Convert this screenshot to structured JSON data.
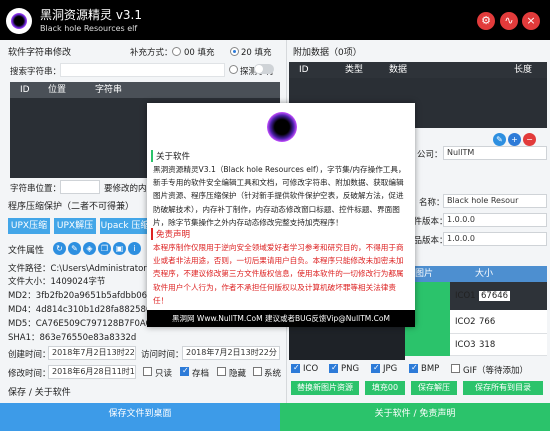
{
  "window": {
    "title": "黑洞资源精灵 v3.1",
    "subtitle": "Black hole Resources elf"
  },
  "left": {
    "string_section": "软件字符串修改",
    "fill_label": "补充方式：",
    "fill_opt1": "00 填充",
    "fill_opt2": "20 填充",
    "search_label": "搜索字符串：",
    "probe_label": "探测字符",
    "table_cols": [
      "ID",
      "位置",
      "字符串"
    ],
    "pos_label": "字符串位置：",
    "modify_label": "要修改的内",
    "compress_section": "程序压缩保护（二者不可得兼）",
    "upx_btns": [
      "UPX压缩",
      "UPX解压",
      "Upack 压缩"
    ],
    "attr_section": "文件属性",
    "path": "文件路径：C:\\Users\\Administrator\\D",
    "size": "文件大小：1409024字节",
    "md2": "MD2：3fb2fb20a9651b5afdbb0667",
    "md4": "MD4：4d814c310b1d28fa8825805",
    "md5": "MD5：CA76E509C797128B7F0AC6",
    "sha1": "SHA1：863e76550e83a8332d",
    "ctime_label": "创建时间：",
    "ctime": "2018年7月2日13时22分",
    "atime_label": "访问时间：",
    "atime": "2018年7月2日13时22分",
    "mtime_label": "修改时间：",
    "mtime": "2018年6月28日11时1分",
    "chk_readonly": "只读",
    "chk_archive": "存档",
    "chk_hidden": "隐藏",
    "chk_system": "系统",
    "save_section": "保存 / 关于软件",
    "save_btn": "保存文件到桌面"
  },
  "right": {
    "attach_section": "附加数据（0项）",
    "table_cols": [
      "ID",
      "类型",
      "数据",
      "长度"
    ],
    "company_label": "公司：",
    "company": "NullTM",
    "name_label": "名称：",
    "name": "Black hole Resour",
    "filever_label": "文件版本：",
    "filever": "1.0.0.0",
    "prodver_label": "产品版本：",
    "prodver": "1.0.0.0",
    "icon_cols": [
      "图片",
      "大小"
    ],
    "icons": [
      {
        "name": "ICO1",
        "size": "67646"
      },
      {
        "name": "ICO2",
        "size": "766"
      },
      {
        "name": "ICO3",
        "size": "318"
      }
    ],
    "fmt_ico": "ICO",
    "fmt_png": "PNG",
    "fmt_jpg": "JPG",
    "fmt_bmp": "BMP",
    "fmt_gif": "GIF（等待添加）",
    "btn_new_icon": "替换新图片资源",
    "btn_fill00": "填充00",
    "btn_save_icon": "保存解压",
    "btn_save_all": "保存所有到目录",
    "about_btn": "关于软件 / 免责声明"
  },
  "popup": {
    "about_title": "关于软件",
    "about_text": "黑洞资源精灵V3.1（Black hole Resources elf），字节集/内存操作工具，新手专用的软件安全编辑工具和文档，可修改字符串、附加数据、获取编辑图片资源、程序压缩保护（针对新手提供软件保护空表，反破解方法，促进防破解技术），内存补丁制作，内存动态修改窗口标题、控件标题、界面图片，除字节集操作之外内存动态修改完整支持加壳程序！",
    "disclaimer_title": "免责声明",
    "disclaimer_text": "本程序制作仅限用于逆向安全领域爱好者学习参考和研究目的，不得用于商业或者非法用途，否则，一切后果请用户自负。本程序只能修改未加密未加壳程序，不建议修改第三方文件版权信息，使用本软件的一切修改行为都属软件用户个人行为，作者不承担任何版权以及计算机破坏罪等相关法律责任！",
    "footer": "黑洞网 Www.NullTM.CoM    建议或者BUG反馈Vip@NullTM.CoM"
  }
}
